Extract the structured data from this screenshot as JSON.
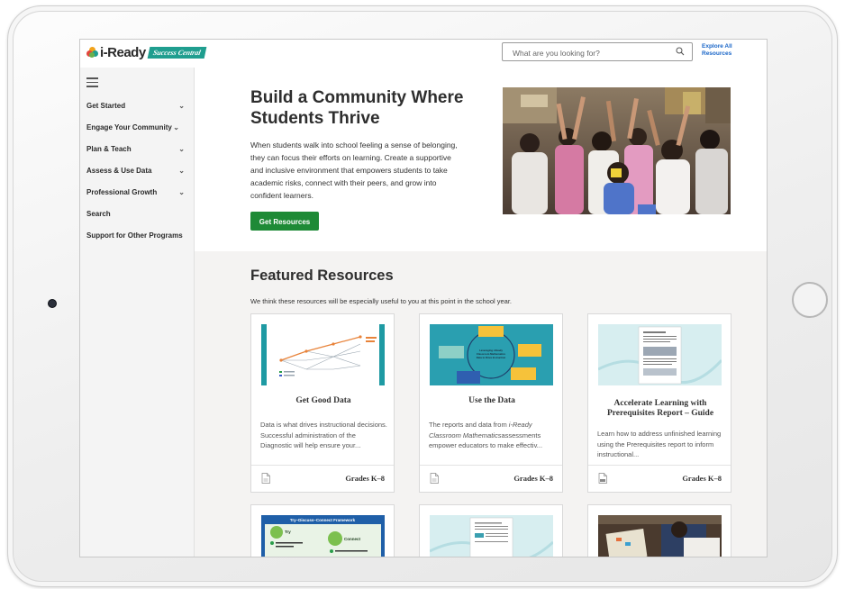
{
  "brand": {
    "name": "i-Ready",
    "badge": "Success Central"
  },
  "header": {
    "search_placeholder": "What are you looking for?",
    "explore_label": "Explore All Resources"
  },
  "sidebar": {
    "items": [
      {
        "label": "Get Started",
        "chevron": true
      },
      {
        "label": "Engage Your Community",
        "chevron": true
      },
      {
        "label": "Plan & Teach",
        "chevron": true
      },
      {
        "label": "Assess & Use Data",
        "chevron": true
      },
      {
        "label": "Professional Growth",
        "chevron": true
      },
      {
        "label": "Search",
        "chevron": false
      },
      {
        "label": "Support for Other Programs",
        "chevron": false
      }
    ]
  },
  "hero": {
    "title": "Build a Community Where Students Thrive",
    "description": "When students walk into school feeling a sense of belonging, they can focus their efforts on learning. Create a supportive and inclusive environment that empowers students to take academic risks, connect with their peers, and grow into confident learners.",
    "button_label": "Get Resources"
  },
  "featured": {
    "title": "Featured Resources",
    "subtitle": "We think these resources will be especially useful to you at this point in the school year.",
    "cards": [
      {
        "title": "Get Good Data",
        "description": "Data is what drives instructional decisions. Successful administration of the Diagnostic will help ensure your...",
        "grades": "Grades K–8",
        "file_type": "document-icon"
      },
      {
        "title": "Use the Data",
        "description_prefix": "The reports and data from ",
        "description_italic": "i-Ready Classroom Mathematics",
        "description_suffix": "assessments empower educators to make effectiv...",
        "grades": "Grades K–8",
        "file_type": "document-icon"
      },
      {
        "title": "Accelerate Learning with Prerequisites Report – Guide",
        "description": "Learn how to address unfinished learning using the Prerequisites report to inform instructional...",
        "grades": "Grades K–8",
        "file_type": "pdf-icon"
      }
    ],
    "row2_thumb_titles": [
      "Try–Discuss–Connect Framework",
      "",
      ""
    ]
  },
  "diagram": {
    "cycle_labels": [
      "Leveraging i-Ready Classroom Mathematics Data to Drive Student-Centered Instruction"
    ],
    "try_label": "Try",
    "connect_label": "Connect"
  },
  "colors": {
    "primary_green": "#1e8a36",
    "link_blue": "#1a66c8",
    "brand_teal": "#1f9e8f"
  }
}
